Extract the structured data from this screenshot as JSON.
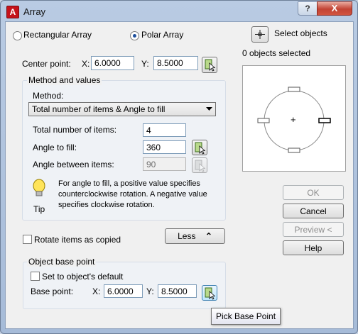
{
  "window": {
    "title": "Array",
    "app_icon": "A",
    "help_glyph": "?",
    "close_glyph": "X"
  },
  "array_type": {
    "rectangular_label": "Rectangular Array",
    "polar_label": "Polar Array",
    "selected": "polar"
  },
  "select_objects": {
    "label": "Select objects",
    "status": "0 objects selected"
  },
  "center_point": {
    "label": "Center point:",
    "x_label": "X:",
    "x_value": "6.0000",
    "y_label": "Y:",
    "y_value": "8.5000"
  },
  "method_values": {
    "group_label": "Method and values",
    "method_label": "Method:",
    "method_selected": "Total number of items & Angle to fill",
    "total_items_label": "Total number of items:",
    "total_items_value": "4",
    "angle_fill_label": "Angle to fill:",
    "angle_fill_value": "360",
    "angle_between_label": "Angle between items:",
    "angle_between_value": "90",
    "tip_text": "For angle to fill, a positive value specifies counterclockwise rotation.  A negative value specifies clockwise rotation.",
    "tip_label": "Tip"
  },
  "rotate_items": {
    "label": "Rotate items as copied",
    "checked": false
  },
  "less_button": {
    "label": "Less",
    "glyph": "⌃"
  },
  "object_base_point": {
    "group_label": "Object base point",
    "default_label": "Set to object's default",
    "default_checked": false,
    "base_point_label": "Base point:",
    "x_label": "X:",
    "x_value": "6.0000",
    "y_label": "Y:",
    "y_value": "8.5000"
  },
  "buttons": {
    "ok": "OK",
    "cancel": "Cancel",
    "preview": "Preview <",
    "help": "Help"
  },
  "tooltip": "Pick Base Point",
  "preview_center_glyph": "+"
}
